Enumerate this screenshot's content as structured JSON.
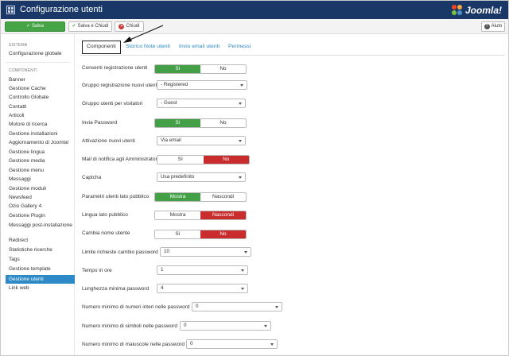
{
  "header": {
    "title": "Configurazione utenti",
    "brand": "Joomla!"
  },
  "toolbar": {
    "save": "Salva",
    "save_close": "Salva e Chiudi",
    "close": "Chiudi",
    "help": "Aiuto"
  },
  "sidebar": {
    "system_heading": "SISTEMA",
    "system_items": [
      "Configurazione globale"
    ],
    "components_heading": "COMPONENTI",
    "items": [
      "Banner",
      "Gestione Cache",
      "Controllo Globale",
      "Contatti",
      "Articoli",
      "Motore di ricerca",
      "Gestione installazioni",
      "Aggiornamento di Joomla!",
      "Gestione lingua",
      "Gestione media",
      "Gestione menu",
      "Messaggi",
      "Gestione moduli",
      "Newsfeed",
      "Ozio Gallery 4",
      "Gestione Plugin",
      "Messaggi post-installazione",
      "Redirect",
      "Statistiche ricerche",
      "Tags",
      "Gestione template",
      "Gestione utenti",
      "Link web"
    ],
    "active_item": "Gestione utenti"
  },
  "tabs": [
    "Componenti",
    "Storico Note utenti",
    "Invio email utenti",
    "Permessi"
  ],
  "active_tab": "Componenti",
  "fields": [
    {
      "label": "Consenti registrazione utenti",
      "type": "toggle",
      "options": [
        "Sì",
        "No"
      ],
      "selected": 0
    },
    {
      "label": "Gruppo registrazione nuovi utenti",
      "type": "select",
      "value": "- Registered"
    },
    {
      "label": "Gruppo utenti per visitatori",
      "type": "select",
      "value": "- Guest"
    },
    {
      "label": "Invia Password",
      "type": "toggle",
      "options": [
        "Sì",
        "No"
      ],
      "selected": 0
    },
    {
      "label": "Attivazione nuovi utenti",
      "type": "select",
      "value": "Via email"
    },
    {
      "label": "Mail di notifica agli Amministratori",
      "type": "toggle",
      "options": [
        "Sì",
        "No"
      ],
      "selected": 1
    },
    {
      "label": "Captcha",
      "type": "select",
      "value": "Usa predefinito"
    },
    {
      "label": "Parametri utenti lato pubblico",
      "type": "toggle",
      "options": [
        "Mostra",
        "Nascondi"
      ],
      "selected": 0
    },
    {
      "label": "Lingua lato pubblico",
      "type": "toggle",
      "options": [
        "Mostra",
        "Nascondi"
      ],
      "selected": 1
    },
    {
      "label": "Cambia nome utente",
      "type": "toggle",
      "options": [
        "Sì",
        "No"
      ],
      "selected": 1
    },
    {
      "label": "Limite richieste cambio password",
      "type": "select",
      "value": "10"
    },
    {
      "label": "Tempo in ore",
      "type": "select",
      "value": "1"
    },
    {
      "label": "Lunghezza minima password",
      "type": "select",
      "value": "4"
    },
    {
      "label": "Numero minimo di numeri interi nelle password",
      "type": "select",
      "value": "0"
    },
    {
      "label": "Numero minimo di simboli nelle password",
      "type": "select",
      "value": "0"
    },
    {
      "label": "Numero minimo di maiuscole nelle password",
      "type": "select",
      "value": "0"
    }
  ],
  "colors": {
    "header_bg": "#1a3867",
    "save_green": "#45a445",
    "toggle_yes": "#43a047",
    "toggle_no": "#c92c2c",
    "active_blue": "#2d8ac7"
  }
}
